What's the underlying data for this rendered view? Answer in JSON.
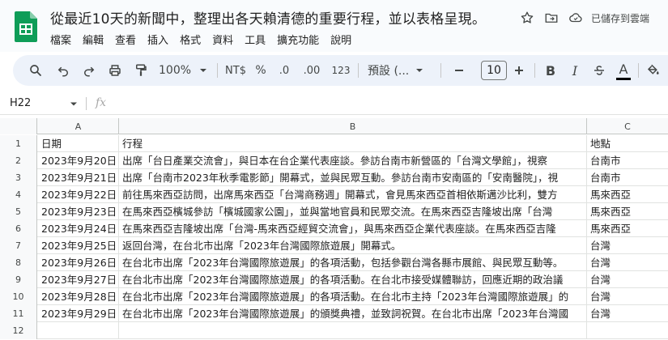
{
  "document": {
    "title": "從最近10天的新聞中，整理出各天賴清德的重要行程，並以表格呈現。",
    "saved_status": "已儲存到雲端"
  },
  "menu": [
    "檔案",
    "編輯",
    "查看",
    "插入",
    "格式",
    "資料",
    "工具",
    "擴充功能",
    "說明"
  ],
  "toolbar": {
    "zoom": "100%",
    "currency": "NT$",
    "percent": "%",
    "decrease_decimal": ".0",
    "increase_decimal": ".00",
    "number_format": "123",
    "font_name": "預設 (...",
    "font_size": "10",
    "bold": "B",
    "italic": "I",
    "text_color_letter": "A"
  },
  "formula_bar": {
    "cell_ref": "H22",
    "fx": "fx"
  },
  "columns": [
    "A",
    "B",
    "C"
  ],
  "rows": [
    {
      "num": "1",
      "a": "日期",
      "b": "行程",
      "c": "地點"
    },
    {
      "num": "2",
      "a": "2023年9月20日",
      "b": "出席「台日產業交流會」，與日本在台企業代表座談。參訪台南市新營區的「台灣文學館」，視察",
      "c": "台南市"
    },
    {
      "num": "3",
      "a": "2023年9月21日",
      "b": "出席「台南市2023年秋季電影節」開幕式，並與民眾互動。參訪台南市安南區的「安南醫院」，視",
      "c": "台南市"
    },
    {
      "num": "4",
      "a": "2023年9月22日",
      "b": "前往馬來西亞訪問，出席馬來西亞「台灣商務週」開幕式，會見馬來西亞首相依斯邁沙比利，雙方",
      "c": "馬來西亞"
    },
    {
      "num": "5",
      "a": "2023年9月23日",
      "b": "在馬來西亞檳城參訪「檳城國家公園」，並與當地官員和民眾交流。在馬來西亞吉隆坡出席「台灣",
      "c": "馬來西亞"
    },
    {
      "num": "6",
      "a": "2023年9月24日",
      "b": "在馬來西亞吉隆坡出席「台灣-馬來西亞經貿交流會」，與馬來西亞企業代表座談。在馬來西亞吉隆",
      "c": "馬來西亞"
    },
    {
      "num": "7",
      "a": "2023年9月25日",
      "b": "返回台灣，在台北市出席「2023年台灣國際旅遊展」開幕式。",
      "c": "台灣"
    },
    {
      "num": "8",
      "a": "2023年9月26日",
      "b": "在台北市出席「2023年台灣國際旅遊展」的各項活動，包括參觀台灣各縣市展館、與民眾互動等。",
      "c": "台灣"
    },
    {
      "num": "9",
      "a": "2023年9月27日",
      "b": "在台北市出席「2023年台灣國際旅遊展」的各項活動。在台北市接受媒體聯訪，回應近期的政治議",
      "c": "台灣"
    },
    {
      "num": "10",
      "a": "2023年9月28日",
      "b": "在台北市出席「2023年台灣國際旅遊展」的各項活動。在台北市主持「2023年台灣國際旅遊展」的",
      "c": "台灣"
    },
    {
      "num": "11",
      "a": "2023年9月29日",
      "b": "在台北市出席「2023年台灣國際旅遊展」的頒獎典禮，並致詞祝賀。在台北市出席「2023年台灣國",
      "c": "台灣"
    },
    {
      "num": "12",
      "a": "",
      "b": "",
      "c": ""
    }
  ]
}
